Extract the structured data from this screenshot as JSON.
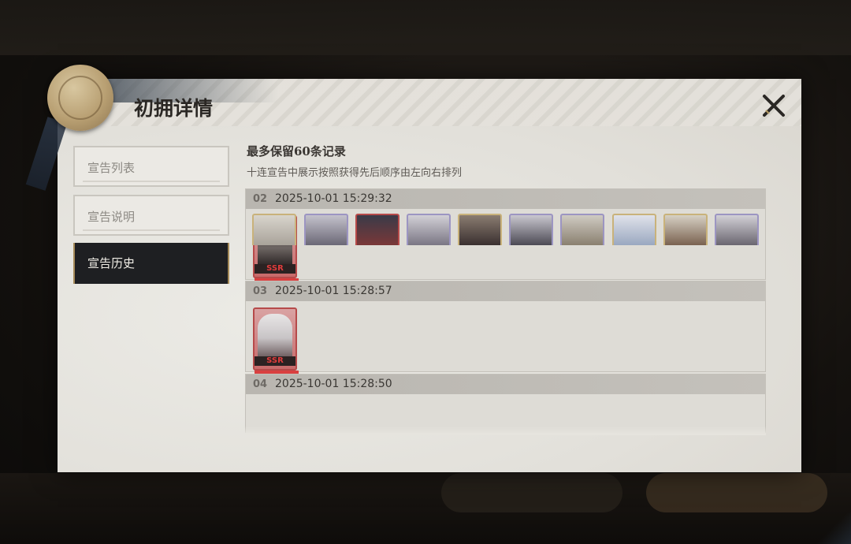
{
  "dialog": {
    "title": "初拥详情",
    "close_icon": "close-icon"
  },
  "tabs": [
    {
      "label": "宣告列表",
      "active": false
    },
    {
      "label": "宣告说明",
      "active": false
    },
    {
      "label": "宣告历史",
      "active": true
    }
  ],
  "history": {
    "notice_title": "最多保留60条记录",
    "notice_sub": "十连宣告中展示按照获得先后顺序由左向右排列",
    "records": [
      {
        "no": "02",
        "time": "2025-10-01 15:29:32",
        "cards": [
          {
            "rarity": "SSR",
            "icon": "character-portrait-icon"
          }
        ]
      },
      {
        "no": "03",
        "time": "2025-10-01 15:28:57",
        "cards": [
          {
            "rarity": "SSR",
            "icon": "character-portrait-icon"
          }
        ]
      },
      {
        "no": "04",
        "time": "2025-10-01 15:28:50",
        "cards": [
          {
            "frame_color": "#c9b27a"
          },
          {
            "frame_color": "#9c95c2"
          },
          {
            "frame_color": "#b64a4a"
          },
          {
            "frame_color": "#9c95c2"
          },
          {
            "frame_color": "#c9b27a"
          },
          {
            "frame_color": "#9c95c2"
          },
          {
            "frame_color": "#9c95c2"
          },
          {
            "frame_color": "#c9b27a"
          },
          {
            "frame_color": "#c9b27a"
          },
          {
            "frame_color": "#9c95c2"
          }
        ]
      }
    ]
  },
  "colors": {
    "ssr_accent": "#e03c3c",
    "active_tab_bg": "#1e1f22",
    "panel_bg": "#e6e4de"
  }
}
